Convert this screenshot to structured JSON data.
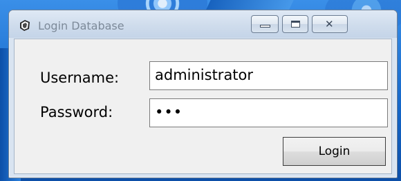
{
  "window": {
    "title": "Login Database",
    "controls": {
      "minimize": "minimize",
      "maximize": "maximize",
      "close": "close"
    }
  },
  "form": {
    "username_label": "Username:",
    "username_value": "administrator",
    "password_label": "Password:",
    "password_value": "•••",
    "login_label": "Login"
  },
  "icons": {
    "app": "app-icon",
    "minimize": "minimize-icon",
    "maximize": "maximize-icon",
    "close": "close-icon"
  }
}
